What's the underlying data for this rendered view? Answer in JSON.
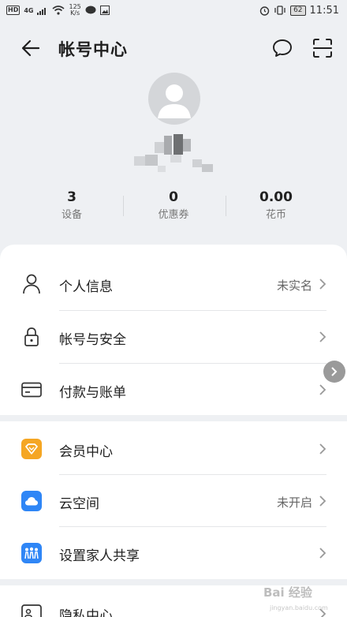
{
  "status_bar": {
    "hd_label": "HD",
    "network": "4G",
    "speed_value": "125",
    "speed_unit": "K/s",
    "battery": "62",
    "time": "11:51"
  },
  "header": {
    "title": "帐号中心",
    "back_icon": "arrow-left-icon",
    "message_icon": "chat-bubble-icon",
    "scan_icon": "scan-icon"
  },
  "profile": {
    "avatar_icon": "default-avatar-icon"
  },
  "stats": [
    {
      "value": "3",
      "label": "设备"
    },
    {
      "value": "0",
      "label": "优惠券"
    },
    {
      "value": "0.00",
      "label": "花币"
    }
  ],
  "section1": [
    {
      "label": "个人信息",
      "value": "未实名",
      "icon": "person-icon"
    },
    {
      "label": "帐号与安全",
      "value": "",
      "icon": "lock-icon"
    },
    {
      "label": "付款与账单",
      "value": "",
      "icon": "card-icon"
    }
  ],
  "section2": [
    {
      "label": "会员中心",
      "value": "",
      "icon": "vip-diamond-icon",
      "color": "#f5a623"
    },
    {
      "label": "云空间",
      "value": "未开启",
      "icon": "cloud-icon",
      "color": "#2f86f6"
    },
    {
      "label": "设置家人共享",
      "value": "",
      "icon": "family-icon",
      "color": "#2f86f6"
    }
  ],
  "section3": [
    {
      "label": "隐私中心",
      "icon": "id-card-icon"
    }
  ],
  "watermark": {
    "text": "Bai 经验",
    "url": "jingyan.baidu.com"
  },
  "colors": {
    "background": "#eef0f3",
    "card": "#ffffff",
    "vip": "#f5a623",
    "blue": "#2f86f6"
  }
}
